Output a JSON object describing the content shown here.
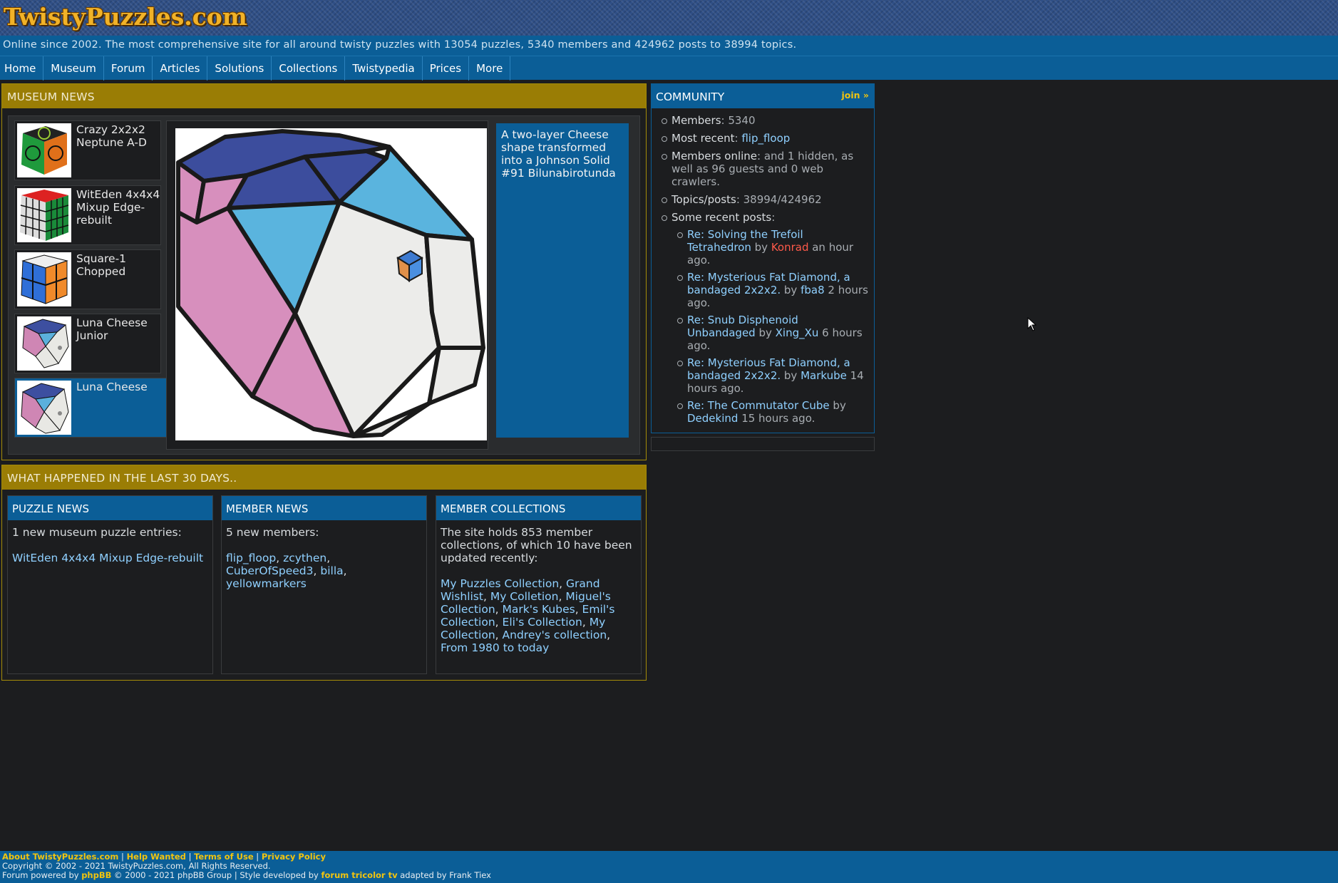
{
  "site": {
    "logo": "TwistyPuzzles.com",
    "tagline": "Online since 2002. The most comprehensive site for all around twisty puzzles with 13054 puzzles, 5340 members and 424962 posts to 38994 topics."
  },
  "nav": [
    "Home",
    "Museum",
    "Forum",
    "Articles",
    "Solutions",
    "Collections",
    "Twistypedia",
    "Prices",
    "More"
  ],
  "museum_news": {
    "title": "MUSEUM NEWS",
    "items": [
      {
        "name": "Crazy 2x2x2 Neptune A-D"
      },
      {
        "name": "WitEden 4x4x4 Mixup Edge-rebuilt"
      },
      {
        "name": "Square-1 Chopped"
      },
      {
        "name": "Luna Cheese Junior"
      },
      {
        "name": "Luna Cheese"
      }
    ],
    "selected_description": "A two-layer Cheese shape transformed into a Johnson Solid #91 Bilunabirotunda"
  },
  "community": {
    "title": "COMMUNITY",
    "join": "join »",
    "members_label": "Members",
    "members_value": ": 5340",
    "recent_label": "Most recent",
    "recent_sep": ": ",
    "recent_member": "flip_floop",
    "online_label": "Members online",
    "online_text": ": and 1 hidden, as well as 96 guests and 0 web crawlers.",
    "topics_label": "Topics/posts",
    "topics_value": ": 38994/424962",
    "recent_posts_label": "Some recent posts",
    "recent_posts_colon": ":",
    "posts": [
      {
        "title": "Re: Solving the Trefoil Tetrahedron",
        "by": " by ",
        "author": "Konrad",
        "when": " an hour ago."
      },
      {
        "title": "Re: Mysterious Fat Diamond, a bandaged 2x2x2.",
        "by": " by ",
        "author": "fba8",
        "when": " 2 hours ago."
      },
      {
        "title": "Re: Snub Disphenoid Unbandaged",
        "by": " by ",
        "author": "Xing_Xu",
        "when": " 6 hours ago."
      },
      {
        "title": "Re: Mysterious Fat Diamond, a bandaged 2x2x2.",
        "by": " by ",
        "author": "Markube",
        "when": " 14 hours ago."
      },
      {
        "title": "Re: The Commutator Cube",
        "by": " by ",
        "author": "Dedekind",
        "when": " 15 hours ago."
      }
    ]
  },
  "last30": {
    "title": "WHAT HAPPENED IN THE LAST 30 DAYS..",
    "puzzle_news": {
      "title": "PUZZLE NEWS",
      "intro": "1 new museum puzzle entries:",
      "entries": [
        "WitEden 4x4x4 Mixup Edge-rebuilt"
      ]
    },
    "member_news": {
      "title": "MEMBER NEWS",
      "intro": "5 new members:",
      "members": [
        "flip_floop",
        "zcythen",
        "CuberOfSpeed3",
        "billa",
        "yellowmarkers"
      ]
    },
    "member_collections": {
      "title": "MEMBER COLLECTIONS",
      "intro": "The site holds 853 member collections, of which 10 have been updated recently:",
      "collections": [
        "My Puzzles Collection",
        "Grand Wishlist",
        "My Colletion",
        "Miguel's Collection",
        "Mark's Kubes",
        "Emil's Collection",
        "Eli's Collection",
        "My Collection",
        "Andrey's collection",
        "From 1980 to today"
      ]
    }
  },
  "footer": {
    "links": [
      "About TwistyPuzzles.com",
      "Help Wanted",
      "Terms of Use",
      "Privacy Policy"
    ],
    "copyright": "Copyright © 2002 - 2021 TwistyPuzzles.com, All Rights Reserved.",
    "powered_prefix": "Forum powered by ",
    "phpbb": "phpBB",
    "powered_mid": " © 2000 - 2021 phpBB Group | Style developed by ",
    "style_link": "forum tricolor tv",
    "powered_suffix": " adapted by Frank Tiex"
  },
  "colors": {
    "accent_blue": "#0b5e97",
    "panel_gold": "#9a7d05",
    "link": "#8fd0ff",
    "author_highlight": "#ff5a4a",
    "footer_link": "#f1c40f"
  }
}
